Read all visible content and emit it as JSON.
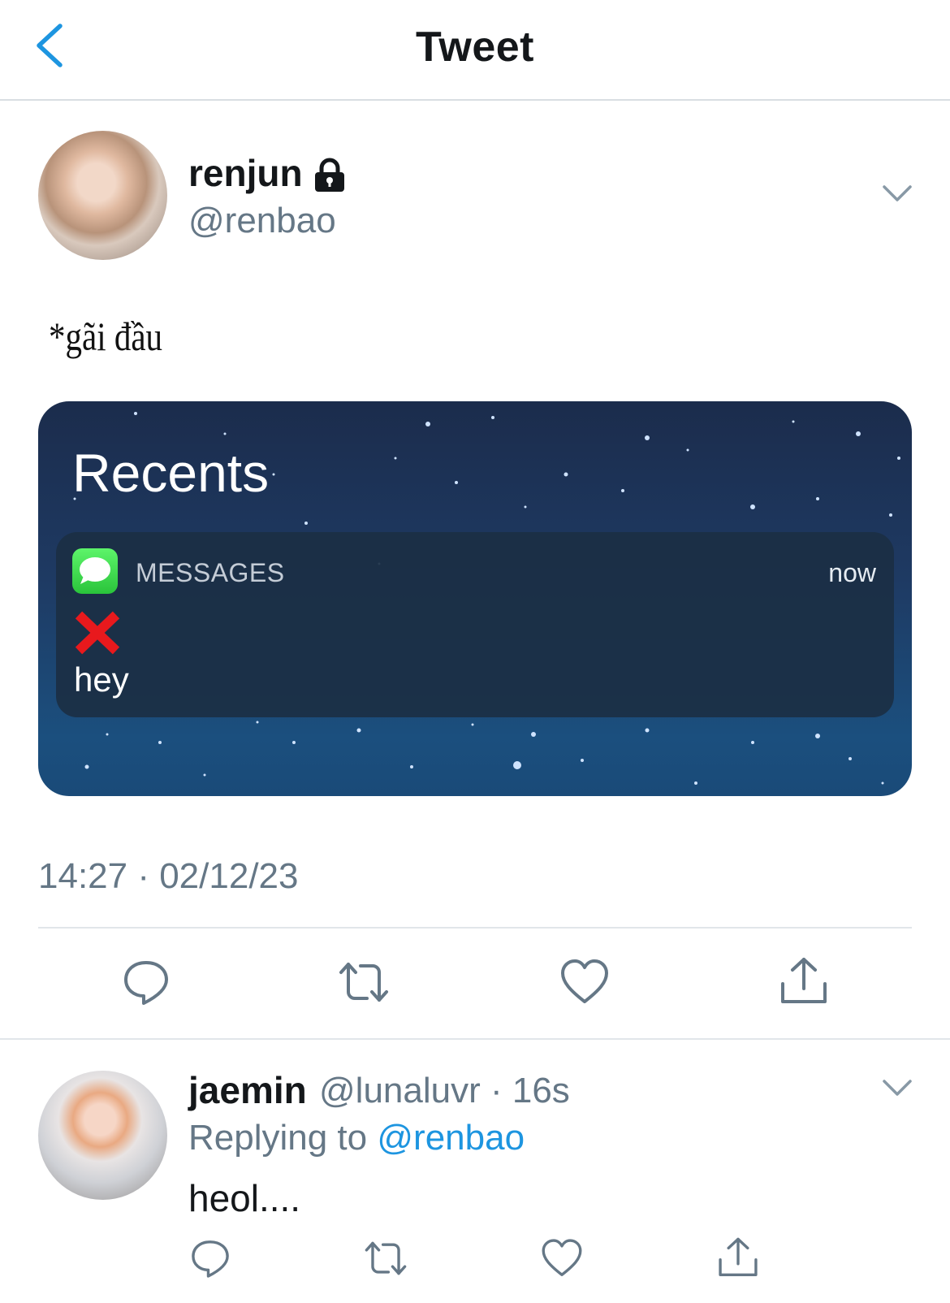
{
  "nav": {
    "title": "Tweet",
    "back_icon": "chevron-left-icon"
  },
  "tweet": {
    "author_name": "renjun",
    "protected_icon": "lock-icon",
    "author_handle": "@renbao",
    "text": "*gãi đầu",
    "timestamp": "14:27 · 02/12/23",
    "image": {
      "title": "Recents",
      "notification": {
        "app_icon": "messages-icon",
        "app_name": "MESSAGES",
        "time": "now",
        "emoji": "red-x-icon",
        "body": "hey"
      }
    },
    "actions": [
      "reply-icon",
      "retweet-icon",
      "like-icon",
      "share-icon"
    ]
  },
  "reply": {
    "author_name": "jaemin",
    "meta": "@lunaluvr · 16s",
    "replying_prefix": "Replying to",
    "replying_handle": "@renbao",
    "text": "heol....",
    "actions": [
      "reply-icon",
      "retweet-icon",
      "like-icon",
      "share-icon"
    ]
  },
  "colors": {
    "accent": "#1d95e0",
    "secondary_text": "#657786",
    "divider": "#e1e6ea"
  }
}
